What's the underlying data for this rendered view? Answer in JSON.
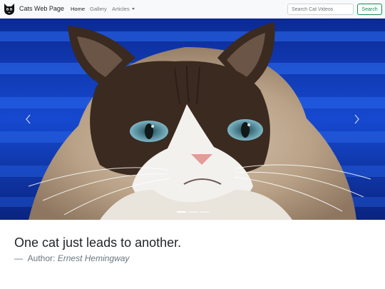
{
  "navbar": {
    "brand": "Cats Web Page",
    "links": [
      {
        "label": "Home",
        "active": true
      },
      {
        "label": "Gallery",
        "active": false
      },
      {
        "label": "Articles",
        "active": false
      }
    ],
    "search": {
      "placeholder": "Search Cat Videos",
      "button_label": "Search"
    }
  },
  "carousel": {
    "slide_count": 3,
    "active_slide": 1,
    "prev_icon": "chevron-left-icon",
    "next_icon": "chevron-right-icon"
  },
  "quote": {
    "text": "One cat just leads to another.",
    "dash": "—",
    "author_label": "Author:",
    "author_name": "Ernest Hemingway"
  },
  "colors": {
    "navbar_bg": "#f8f9fa",
    "search_button": "#198754",
    "muted_text": "#6c757d"
  }
}
